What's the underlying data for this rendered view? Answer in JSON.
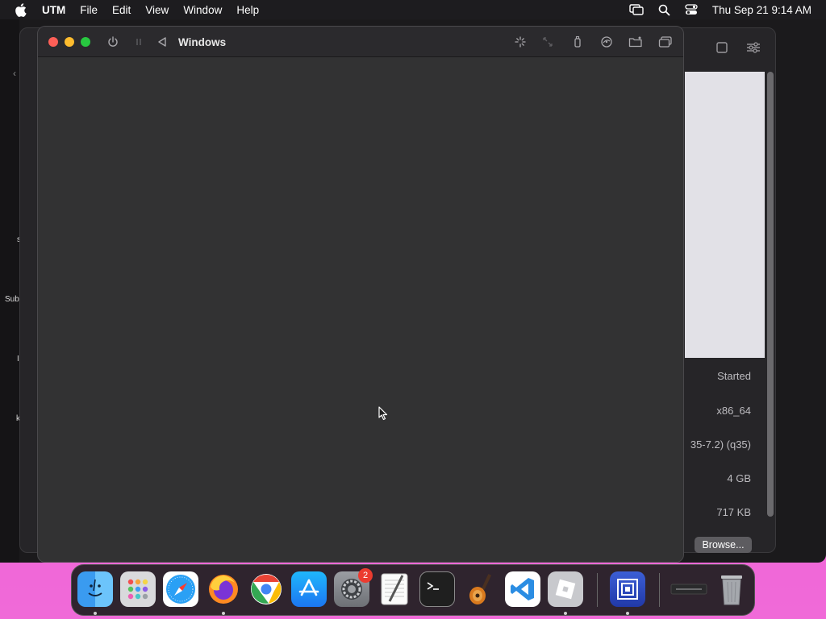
{
  "menubar": {
    "app_name": "UTM",
    "items": [
      "File",
      "Edit",
      "View",
      "Window",
      "Help"
    ],
    "clock": "Thu Sep 21  9:14 AM"
  },
  "sidebar_fragments": [
    "s",
    "Sub",
    "I",
    "k"
  ],
  "vm_window": {
    "title": "Windows"
  },
  "vm_info": {
    "status": "Started",
    "architecture": "x86_64",
    "machine": "35-7.2) (q35)",
    "memory": "4 GB",
    "size": "717 KB",
    "browse_label": "Browse..."
  },
  "dock": {
    "apps": [
      "Finder",
      "Launchpad",
      "Safari",
      "Firefox",
      "Chrome",
      "App Store",
      "System Settings",
      "TextEdit",
      "Terminal",
      "GarageBand",
      "Visual Studio Code",
      "Roblox",
      "UTM",
      "Preview Window",
      "Trash"
    ],
    "settings_badge": "2"
  },
  "colors": {
    "desktop": "#ef5fd6",
    "menubar": "#1d1c1f",
    "window": "#323233",
    "close": "#fe5f57",
    "minimize": "#febc2e",
    "zoom": "#28c840"
  }
}
